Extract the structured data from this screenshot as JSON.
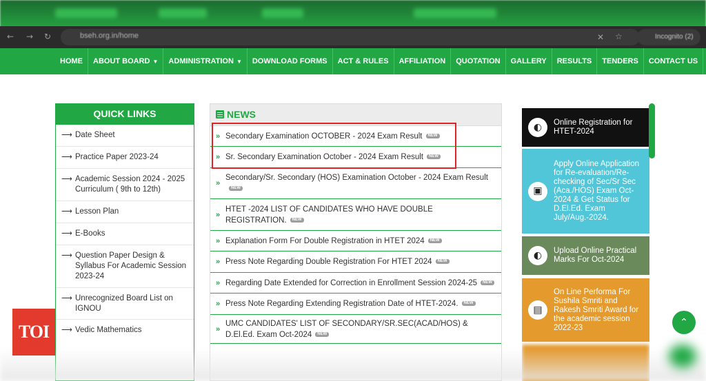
{
  "browser": {
    "url": "bseh.org.in/home",
    "profile_label": "Incognito (2)",
    "back_icon": "arrow-left-icon",
    "forward_icon": "arrow-right-icon",
    "reload_icon": "reload-icon"
  },
  "nav": {
    "items": [
      {
        "label": "HOME",
        "dropdown": false
      },
      {
        "label": "ABOUT BOARD",
        "dropdown": true
      },
      {
        "label": "ADMINISTRATION",
        "dropdown": true
      },
      {
        "label": "DOWNLOAD FORMS",
        "dropdown": false
      },
      {
        "label": "ACT & RULES",
        "dropdown": false
      },
      {
        "label": "AFFILIATION",
        "dropdown": false
      },
      {
        "label": "QUOTATION",
        "dropdown": false
      },
      {
        "label": "GALLERY",
        "dropdown": false
      },
      {
        "label": "RESULTS",
        "dropdown": false
      },
      {
        "label": "TENDERS",
        "dropdown": false
      },
      {
        "label": "CONTACT US",
        "dropdown": false
      }
    ]
  },
  "quick_links": {
    "title": "QUICK LINKS",
    "items": [
      "Date Sheet",
      "Practice Paper 2023-24",
      "Academic Session 2024 - 2025 Curriculum ( 9th to 12th)",
      "Lesson Plan",
      "E-Books",
      "Question Paper Design & Syllabus For Academic Session 2023-24",
      "Unrecognized Board List on IGNOU",
      "Vedic Mathematics"
    ]
  },
  "news": {
    "title": "NEWS",
    "new_badge": "NEW",
    "items": [
      "Secondary Examination OCTOBER - 2024 Exam Result",
      "Sr. Secondary Examination October - 2024 Exam Result",
      "Secondary/Sr. Secondary (HOS) Examination October - 2024 Exam Result",
      "HTET -2024 LIST OF CANDIDATES WHO HAVE DOUBLE REGISTRATION.",
      "Explanation Form For Double Registration in HTET 2024",
      "Press Note Regarding Double Registration For HTET 2024",
      "Regarding Date Extended for Correction in Enrollment Session 2024-25",
      "Press Note Regarding Extending Registration Date of HTET-2024.",
      "UMC CANDIDATES' LIST OF SECONDARY/SR.SEC(ACAD/HOS) & D.El.Ed. Exam Oct-2024"
    ]
  },
  "tiles": [
    {
      "label": "Online Registration for HTET-2024",
      "icon": "half-circle-icon",
      "color": "#111111"
    },
    {
      "label": "Apply Online Application for Re-evaluation/Re-checking of Sec/Sr Sec (Aca./HOS) Exam Oct-2024 & Get Status for D.El.Ed. Exam July/Aug.-2024.",
      "icon": "id-badge-icon",
      "color": "#52c6d9"
    },
    {
      "label": "Upload Online Practical Marks For Oct-2024",
      "icon": "half-circle-icon",
      "color": "#6b8a5c"
    },
    {
      "label": "On Line Performa For Sushila Smriti and Rakesh Smriti Award for the academic session 2022-23",
      "icon": "id-card-icon",
      "color": "#e59a2d"
    }
  ],
  "watermark": "TOI",
  "colors": {
    "brand_green": "#21a845",
    "highlight_red": "#e02424"
  }
}
